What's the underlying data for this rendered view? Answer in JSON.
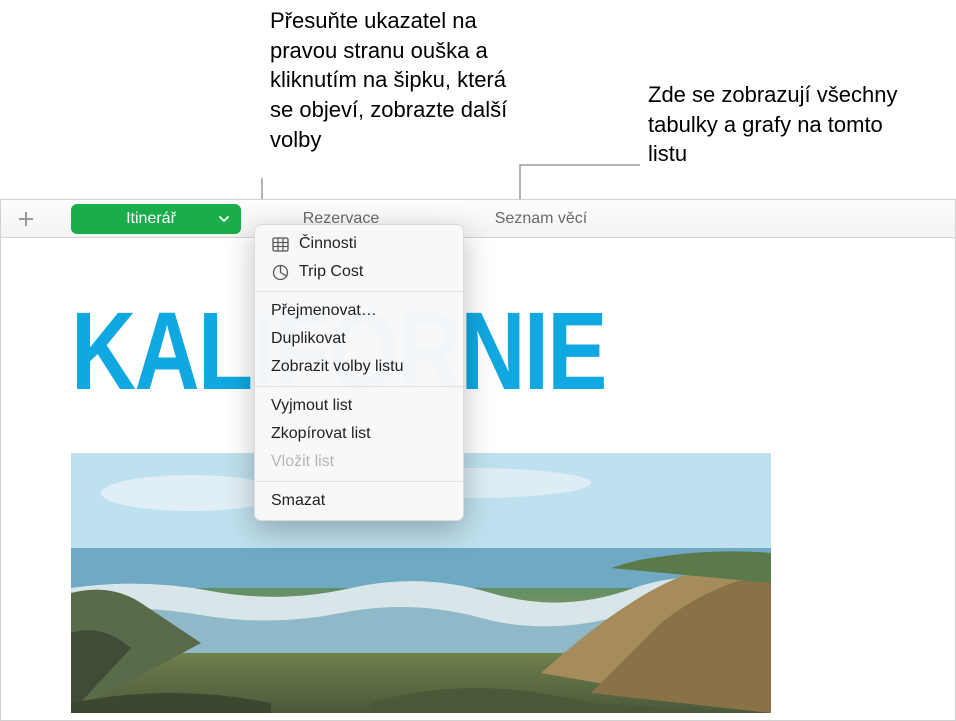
{
  "callouts": {
    "left": "Přesuňte ukazatel na pravou stranu ouška a kliknutím na šipku, která se objeví, zobrazte další volby",
    "right": "Zde se zobrazují všechny tabulky a grafy na tomto listu"
  },
  "tabs": {
    "active": "Itinerář",
    "second": "Rezervace",
    "third": "Seznam věcí"
  },
  "menu": {
    "activities": "Činnosti",
    "tripcost": "Trip Cost",
    "rename": "Přejmenovat…",
    "duplicate": "Duplikovat",
    "showopts": "Zobrazit volby listu",
    "cut": "Vyjmout list",
    "copy": "Zkopírovat list",
    "paste": "Vložit list",
    "delete": "Smazat"
  },
  "content": {
    "title": "KALIFORNIE"
  }
}
